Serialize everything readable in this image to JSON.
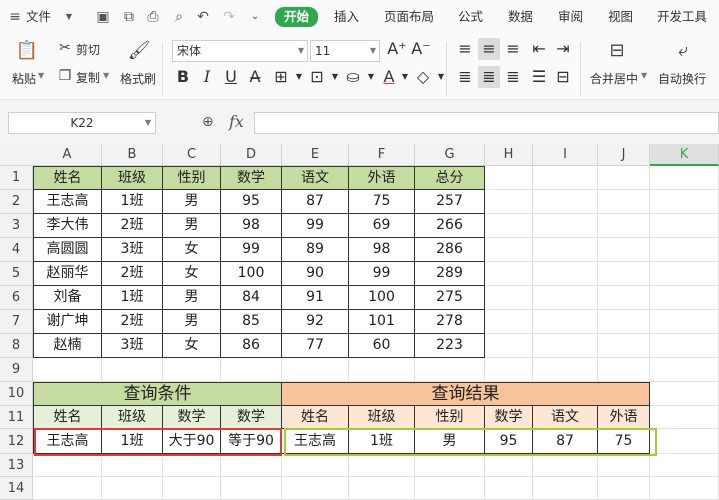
{
  "menu": {
    "file_label": "文件",
    "tabs": [
      "开始",
      "插入",
      "页面布局",
      "公式",
      "数据",
      "审阅",
      "视图",
      "开发工具"
    ]
  },
  "ribbon": {
    "paste_label": "粘贴",
    "cut_label": "剪切",
    "copy_label": "复制",
    "format_painter_label": "格式刷",
    "font_name": "宋体",
    "font_size": "11",
    "merge_label": "合并居中",
    "wrap_label": "自动换行"
  },
  "formula_bar": {
    "name_box": "K22",
    "fx_label": "fx",
    "formula": ""
  },
  "grid": {
    "columns": [
      "A",
      "B",
      "C",
      "D",
      "E",
      "F",
      "G",
      "H",
      "I",
      "J",
      "K"
    ],
    "rows": [
      "1",
      "2",
      "3",
      "4",
      "5",
      "6",
      "7",
      "8",
      "9",
      "10",
      "11",
      "12",
      "13",
      "14"
    ],
    "selected_column": "K"
  },
  "data_table": {
    "headers": [
      "姓名",
      "班级",
      "性别",
      "数学",
      "语文",
      "外语",
      "总分"
    ],
    "rows": [
      [
        "王志高",
        "1班",
        "男",
        "95",
        "87",
        "75",
        "257"
      ],
      [
        "李大伟",
        "2班",
        "男",
        "98",
        "99",
        "69",
        "266"
      ],
      [
        "高圆圆",
        "3班",
        "女",
        "99",
        "89",
        "98",
        "286"
      ],
      [
        "赵丽华",
        "2班",
        "女",
        "100",
        "90",
        "99",
        "289"
      ],
      [
        "刘备",
        "1班",
        "男",
        "84",
        "91",
        "100",
        "275"
      ],
      [
        "谢广坤",
        "2班",
        "男",
        "85",
        "92",
        "101",
        "278"
      ],
      [
        "赵楠",
        "3班",
        "女",
        "86",
        "77",
        "60",
        "223"
      ]
    ]
  },
  "criteria": {
    "title": "查询条件",
    "headers": [
      "姓名",
      "班级",
      "数学",
      "数学"
    ],
    "values": [
      "王志高",
      "1班",
      "大于90",
      "等于90"
    ]
  },
  "results": {
    "title": "查询结果",
    "headers": [
      "姓名",
      "班级",
      "性别",
      "数学",
      "语文",
      "外语"
    ],
    "values": [
      "王志高",
      "1班",
      "男",
      "95",
      "87",
      "75"
    ]
  },
  "colors": {
    "accent": "#2fa84f",
    "criteria_box": "#e03a3a",
    "result_box": "#a8c93a"
  }
}
